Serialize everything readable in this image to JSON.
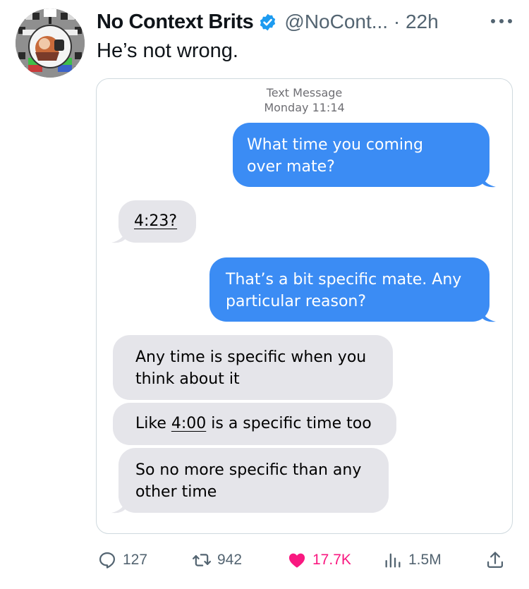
{
  "tweet": {
    "author_name": "No Context Brits",
    "handle_and_time": "@NoCont... · 22h",
    "text": "He’s not wrong.",
    "verified_color": "#1d9bf0"
  },
  "image": {
    "header_line1": "Text Message",
    "header_line2": "Monday 11:14",
    "messages": [
      {
        "side": "sent",
        "text": "What time you coming\nover mate?"
      },
      {
        "side": "received",
        "text": "4:23?"
      },
      {
        "side": "sent",
        "text": "That’s a bit specific mate. Any\nparticular reason?"
      },
      {
        "side": "received",
        "text": "Any time is specific when you\nthink about it"
      },
      {
        "side": "received",
        "prefix": "Like ",
        "link": "4:00",
        "suffix": " is a specific time too"
      },
      {
        "side": "received",
        "text": "So no more specific than any\nother time"
      }
    ],
    "sent_color": "#3b8cf4",
    "received_color": "#e5e5ea"
  },
  "actions": {
    "replies": "127",
    "reposts": "942",
    "likes": "17.7K",
    "views": "1.5M",
    "like_color": "#f91880"
  }
}
